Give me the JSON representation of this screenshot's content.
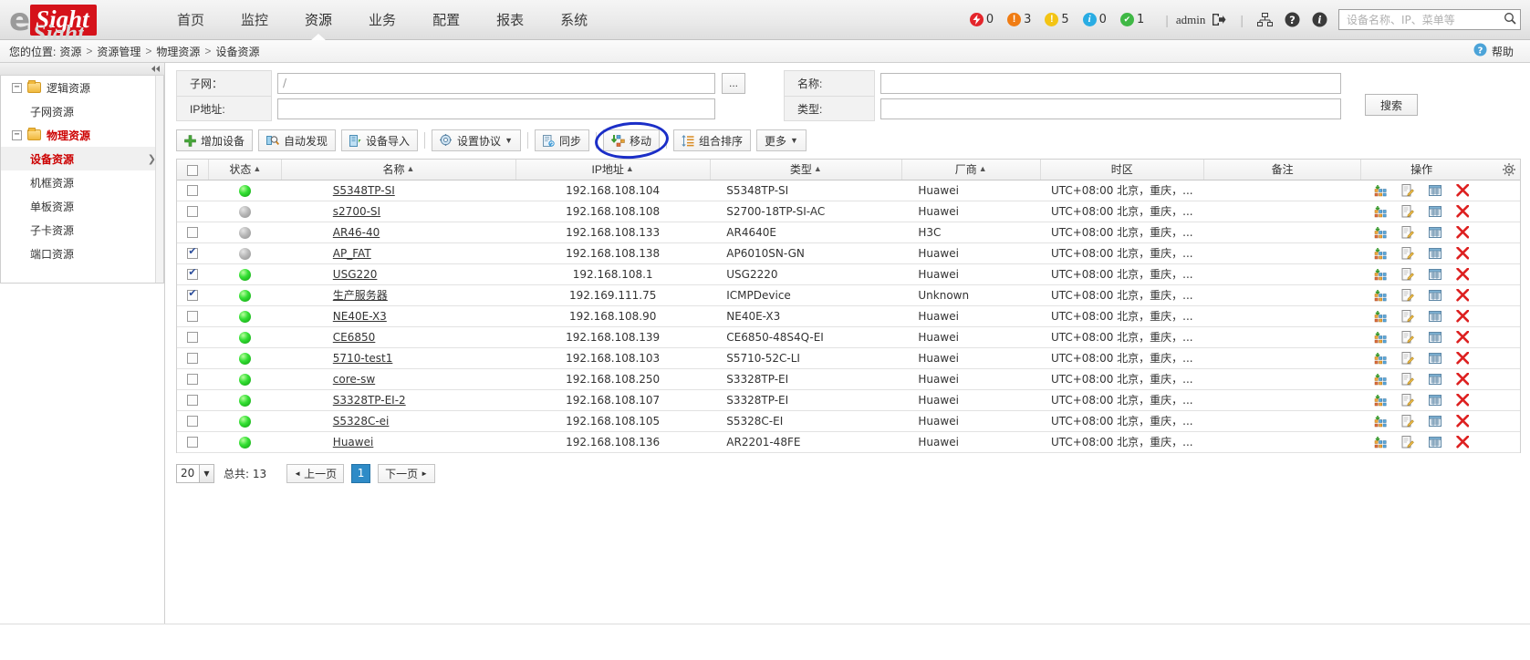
{
  "app": {
    "logo_left": "e",
    "logo_right": "Sight",
    "logo_ghost": "Sight"
  },
  "nav": {
    "items": [
      {
        "label": "首页",
        "active": false
      },
      {
        "label": "监控",
        "active": false
      },
      {
        "label": "资源",
        "active": true
      },
      {
        "label": "业务",
        "active": false
      },
      {
        "label": "配置",
        "active": false
      },
      {
        "label": "报表",
        "active": false
      },
      {
        "label": "系统",
        "active": false
      }
    ]
  },
  "header_right": {
    "alarms": [
      {
        "name": "critical",
        "glyph": "⚡",
        "count": "0",
        "color": "#e4252b"
      },
      {
        "name": "major",
        "glyph": "!",
        "count": "3",
        "color": "#f07c13"
      },
      {
        "name": "minor",
        "glyph": "!",
        "count": "5",
        "color": "#f3c414"
      },
      {
        "name": "warning",
        "glyph": "i",
        "count": "0",
        "color": "#29ace3"
      },
      {
        "name": "cleared",
        "glyph": "✔",
        "count": "1",
        "color": "#3fb845"
      }
    ],
    "user": "admin",
    "icons": [
      "logout-icon",
      "topology-icon",
      "help-icon",
      "about-icon"
    ],
    "search_placeholder": "设备名称、IP、菜单等"
  },
  "breadcrumb": {
    "prefix": "您的位置:",
    "items": [
      "资源",
      "资源管理",
      "物理资源",
      "设备资源"
    ],
    "separator": ">",
    "help_label": "帮助"
  },
  "sidebar": {
    "tree": [
      {
        "label": "逻辑资源",
        "type": "folder",
        "expanded": true,
        "selected": false
      },
      {
        "label": "子网资源",
        "type": "leaf",
        "selected": false
      },
      {
        "label": "物理资源",
        "type": "folder",
        "expanded": true,
        "selected": false,
        "highlight": true
      },
      {
        "label": "设备资源",
        "type": "leaf",
        "selected": true
      },
      {
        "label": "机框资源",
        "type": "leaf",
        "selected": false
      },
      {
        "label": "单板资源",
        "type": "leaf",
        "selected": false
      },
      {
        "label": "子卡资源",
        "type": "leaf",
        "selected": false
      },
      {
        "label": "端口资源",
        "type": "leaf",
        "selected": false
      }
    ]
  },
  "filter": {
    "subnet_label": "子网：",
    "subnet_value": "/",
    "ip_label": "IP地址:",
    "ip_value": "",
    "name_label": "名称:",
    "name_value": "",
    "type_label": "类型:",
    "type_value": "",
    "browse_label": "...",
    "search_label": "搜索"
  },
  "toolbar": {
    "buttons": [
      {
        "label": "增加设备",
        "icon": "plus-icon",
        "caret": false,
        "highlighted": false
      },
      {
        "label": "自动发现",
        "icon": "autodiscover-icon",
        "caret": false,
        "highlighted": false
      },
      {
        "label": "设备导入",
        "icon": "import-icon",
        "caret": false,
        "highlighted": false
      },
      {
        "label": "设置协议",
        "icon": "protocol-gear-icon",
        "caret": true,
        "highlighted": false
      },
      {
        "label": "同步",
        "icon": "sync-icon",
        "caret": false,
        "highlighted": false
      },
      {
        "label": "移动",
        "icon": "move-icon",
        "caret": false,
        "highlighted": true
      },
      {
        "label": "组合排序",
        "icon": "sort-icon",
        "caret": false,
        "highlighted": false
      },
      {
        "label": "更多",
        "icon": "",
        "caret": true,
        "highlighted": false
      }
    ],
    "highlight_color": "#1b2ec7"
  },
  "table": {
    "columns": [
      {
        "label": "",
        "sort": false,
        "name": "select-all"
      },
      {
        "label": "状态",
        "sort": true,
        "name": "status"
      },
      {
        "label": "名称",
        "sort": true,
        "name": "name"
      },
      {
        "label": "IP地址",
        "sort": true,
        "name": "ip"
      },
      {
        "label": "类型",
        "sort": true,
        "name": "type"
      },
      {
        "label": "厂商",
        "sort": true,
        "name": "vendor"
      },
      {
        "label": "时区",
        "sort": false,
        "name": "timezone"
      },
      {
        "label": "备注",
        "sort": false,
        "name": "remark"
      },
      {
        "label": "操作",
        "sort": false,
        "name": "operation"
      }
    ],
    "rows": [
      {
        "checked": false,
        "status": "up",
        "name": "S5348TP-SI",
        "ip": "192.168.108.104",
        "type": "S5348TP-SI",
        "vendor": "Huawei",
        "timezone": "UTC+08:00 北京，重庆，...",
        "remark": ""
      },
      {
        "checked": false,
        "status": "down",
        "name": "s2700-SI",
        "ip": "192.168.108.108",
        "type": "S2700-18TP-SI-AC",
        "vendor": "Huawei",
        "timezone": "UTC+08:00 北京，重庆，...",
        "remark": ""
      },
      {
        "checked": false,
        "status": "down",
        "name": "AR46-40",
        "ip": "192.168.108.133",
        "type": "AR4640E",
        "vendor": "H3C",
        "timezone": "UTC+08:00 北京，重庆，...",
        "remark": ""
      },
      {
        "checked": true,
        "status": "down",
        "name": "AP_FAT",
        "ip": "192.168.108.138",
        "type": "AP6010SN-GN",
        "vendor": "Huawei",
        "timezone": "UTC+08:00 北京，重庆，...",
        "remark": ""
      },
      {
        "checked": true,
        "status": "up",
        "name": "USG220",
        "ip": "192.168.108.1",
        "type": "USG2220",
        "vendor": "Huawei",
        "timezone": "UTC+08:00 北京，重庆，...",
        "remark": ""
      },
      {
        "checked": true,
        "status": "up",
        "name": "生产服务器",
        "ip": "192.169.111.75",
        "type": "ICMPDevice",
        "vendor": "Unknown",
        "timezone": "UTC+08:00 北京，重庆，...",
        "remark": ""
      },
      {
        "checked": false,
        "status": "up",
        "name": "NE40E-X3",
        "ip": "192.168.108.90",
        "type": "NE40E-X3",
        "vendor": "Huawei",
        "timezone": "UTC+08:00 北京，重庆，...",
        "remark": ""
      },
      {
        "checked": false,
        "status": "up",
        "name": "CE6850",
        "ip": "192.168.108.139",
        "type": "CE6850-48S4Q-EI",
        "vendor": "Huawei",
        "timezone": "UTC+08:00 北京，重庆，...",
        "remark": ""
      },
      {
        "checked": false,
        "status": "up",
        "name": "5710-test1",
        "ip": "192.168.108.103",
        "type": "S5710-52C-LI",
        "vendor": "Huawei",
        "timezone": "UTC+08:00 北京，重庆，...",
        "remark": ""
      },
      {
        "checked": false,
        "status": "up",
        "name": "core-sw",
        "ip": "192.168.108.250",
        "type": "S3328TP-EI",
        "vendor": "Huawei",
        "timezone": "UTC+08:00 北京，重庆，...",
        "remark": ""
      },
      {
        "checked": false,
        "status": "up",
        "name": "S3328TP-EI-2",
        "ip": "192.168.108.107",
        "type": "S3328TP-EI",
        "vendor": "Huawei",
        "timezone": "UTC+08:00 北京，重庆，...",
        "remark": ""
      },
      {
        "checked": false,
        "status": "up",
        "name": "S5328C-ei",
        "ip": "192.168.108.105",
        "type": "S5328C-EI",
        "vendor": "Huawei",
        "timezone": "UTC+08:00 北京，重庆，...",
        "remark": ""
      },
      {
        "checked": false,
        "status": "up",
        "name": "Huawei",
        "ip": "192.168.108.136",
        "type": "AR2201-48FE",
        "vendor": "Huawei",
        "timezone": "UTC+08:00 北京，重庆，...",
        "remark": ""
      }
    ],
    "row_actions": [
      "topology-icon",
      "edit-icon",
      "detail-icon",
      "delete-icon"
    ],
    "settings_icon": "gear-icon"
  },
  "pager": {
    "page_size": "20",
    "total_label": "总共: 13",
    "prev_label": "上一页",
    "next_label": "下一页",
    "current_page": "1"
  }
}
